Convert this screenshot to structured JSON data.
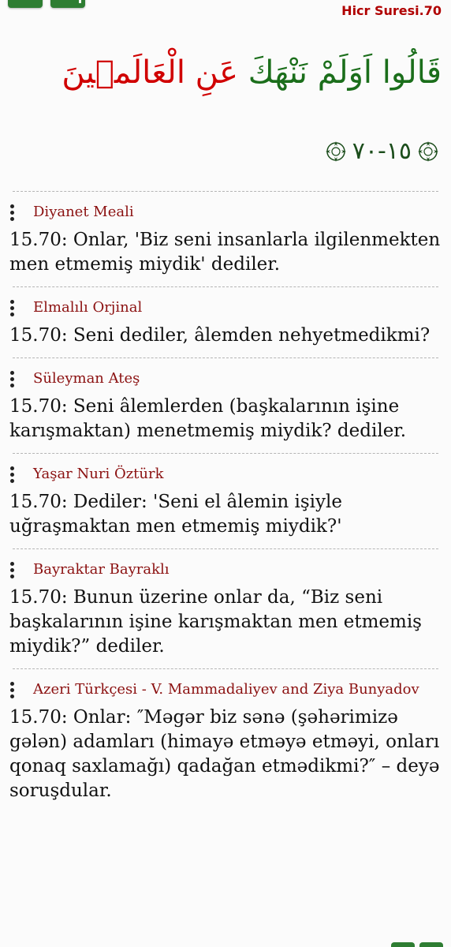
{
  "header": {
    "surah_title": "Hicr Suresi.70",
    "nav_buttons": [
      "menu-button",
      "share-button"
    ]
  },
  "verse": {
    "arabic_green": "قَالُوا اَوَلَمْ نَنْهَكَ",
    "arabic_red": "عَنِ الْعَالَمٖينَ",
    "ayah_marker": "١٥-٧٠"
  },
  "translations": [
    {
      "source": "Diyanet Meali",
      "text": "15.70: Onlar, 'Biz seni insanlarla ilgilenmekten men etmemiş miydik' dediler."
    },
    {
      "source": "Elmalılı Orjinal",
      "text": "15.70: Seni dediler, âlemden nehyetmedikmi?"
    },
    {
      "source": "Süleyman Ateş",
      "text": "15.70: Seni âlemlerden (başkalarının işine karışmaktan) menetmemiş miydik? dediler."
    },
    {
      "source": "Yaşar Nuri Öztürk",
      "text": "15.70: Dediler: 'Seni el âlemin işiyle uğraşmaktan men etmemiş miydik?'"
    },
    {
      "source": "Bayraktar Bayraklı",
      "text": "15.70: Bunun üzerine onlar da, “Biz seni başkalarının işine karışmaktan men etmemiş miydik?” dediler."
    },
    {
      "source": "Azeri Türkçesi - V. Mammadaliyev and Ziya Bunyadov",
      "text": "15.70: Onlar: ″Məgər biz sənə (şəhərimizə gələn) adamları (himayə etməyə etməyi, onları qonaq saxlamağı) qadağan etmədikmi?″ – deyə soruşdular."
    }
  ],
  "colors": {
    "title_red": "#b00000",
    "arabic_green": "#1b6e1b",
    "arabic_red": "#d00000",
    "source_red": "#8b1010",
    "button_green": "#2e7d32"
  }
}
